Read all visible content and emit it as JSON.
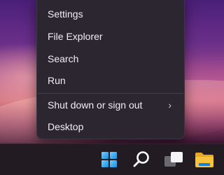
{
  "menu": {
    "items": [
      {
        "label": "Settings"
      },
      {
        "label": "File Explorer"
      },
      {
        "label": "Search"
      },
      {
        "label": "Run"
      },
      {
        "label": "Shut down or sign out",
        "submenu_indicator": "›"
      },
      {
        "label": "Desktop"
      }
    ]
  },
  "taskbar": {
    "icons": [
      "windows-start-icon",
      "search-icon",
      "task-view-icon",
      "file-explorer-icon"
    ]
  },
  "colors": {
    "menu_bg": "#2b2630",
    "menu_text": "#f2eef4",
    "taskbar_bg": "#221b21",
    "accent_blue": "#1a8ee0",
    "folder_yellow": "#f6c33c"
  }
}
